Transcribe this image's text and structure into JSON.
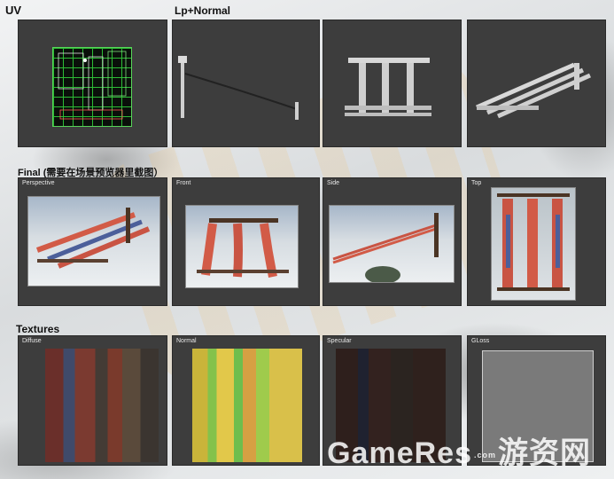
{
  "sections": {
    "uv": "UV",
    "lp_normal": "Lp+Normal",
    "final": "Final (需要在场景预览器里截图）",
    "textures": "Textures"
  },
  "final_panels": [
    "Perspective",
    "Front",
    "Side",
    "Top"
  ],
  "texture_panels": [
    "Diffuse",
    "Normal",
    "Specular",
    "GLoss"
  ],
  "watermark": {
    "brand": "GameRes",
    "dot": ".com",
    "cn": "游资网"
  }
}
